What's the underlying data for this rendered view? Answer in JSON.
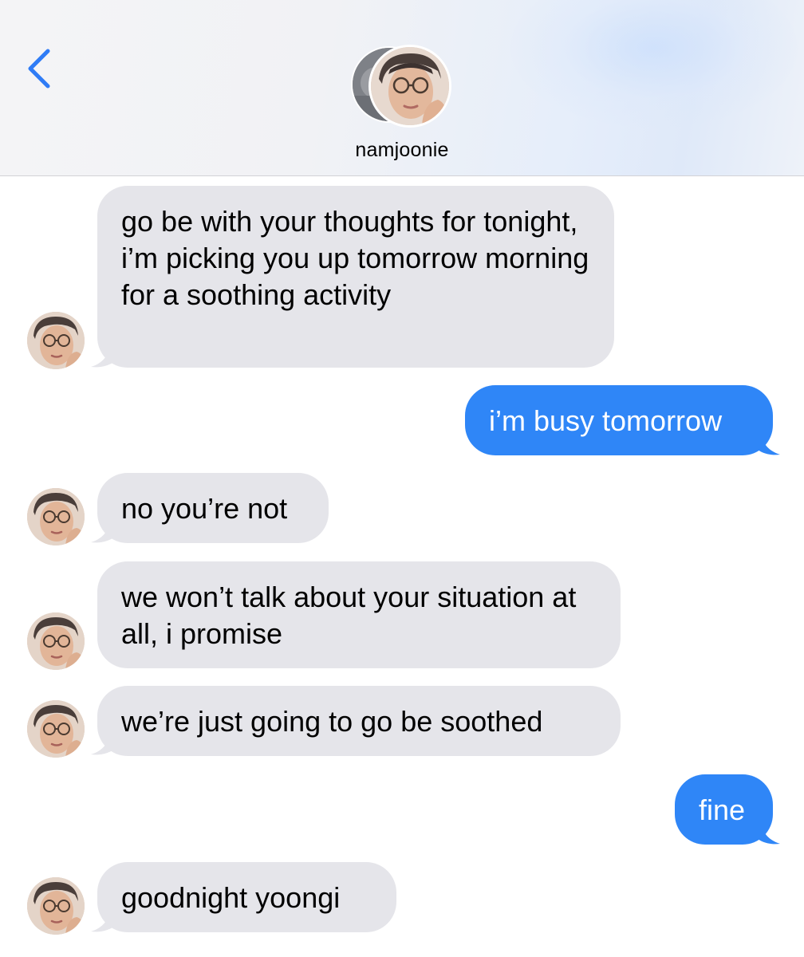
{
  "header": {
    "back_icon": "chevron-left-icon",
    "contact_name": "namjoonie",
    "accent_color": "#2f7cf6"
  },
  "conversation": {
    "messages": [
      {
        "direction": "received",
        "text": "go be with your thoughts for tonight, i’m picking you up tomorrow morning for a soothing activity",
        "show_avatar": true
      },
      {
        "direction": "sent",
        "text": "i’m busy tomorrow"
      },
      {
        "direction": "received",
        "text": "no you’re not",
        "show_avatar": true
      },
      {
        "direction": "received",
        "text": "we won’t talk about your situation at all, i promise",
        "show_avatar": true
      },
      {
        "direction": "received",
        "text": "we’re just going to go be soothed",
        "show_avatar": true
      },
      {
        "direction": "sent",
        "text": "fine"
      },
      {
        "direction": "received",
        "text": "goodnight yoongi",
        "show_avatar": true
      }
    ]
  },
  "colors": {
    "sent_bubble": "#2f86f7",
    "received_bubble": "#e5e5ea",
    "sent_text": "#ffffff",
    "received_text": "#000000"
  }
}
